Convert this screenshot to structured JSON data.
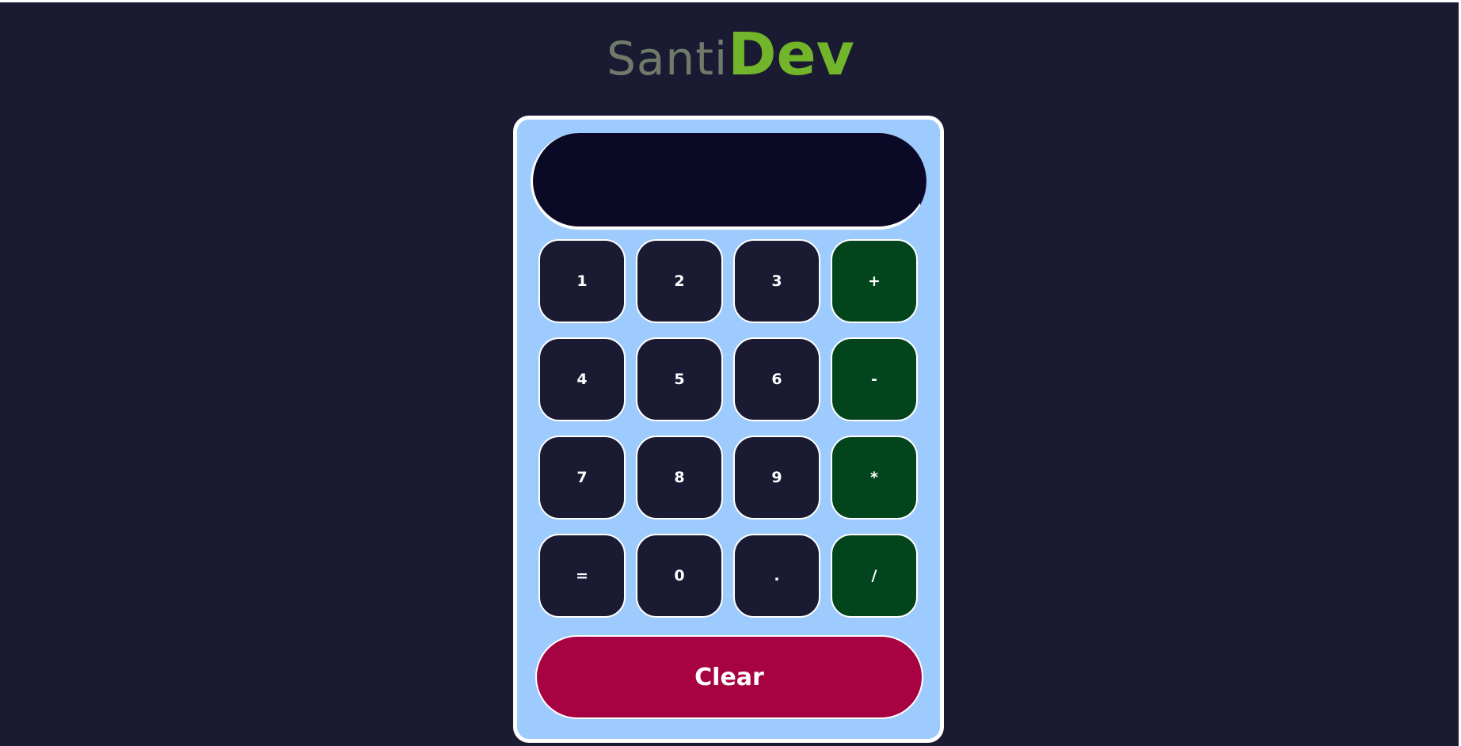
{
  "logo": {
    "part1": "Santi",
    "part2": "Dev"
  },
  "display": {
    "value": ""
  },
  "keys": [
    {
      "label": "1",
      "type": "digit"
    },
    {
      "label": "2",
      "type": "digit"
    },
    {
      "label": "3",
      "type": "digit"
    },
    {
      "label": "+",
      "type": "operator"
    },
    {
      "label": "4",
      "type": "digit"
    },
    {
      "label": "5",
      "type": "digit"
    },
    {
      "label": "6",
      "type": "digit"
    },
    {
      "label": "-",
      "type": "operator"
    },
    {
      "label": "7",
      "type": "digit"
    },
    {
      "label": "8",
      "type": "digit"
    },
    {
      "label": "9",
      "type": "digit"
    },
    {
      "label": "*",
      "type": "operator"
    },
    {
      "label": "=",
      "type": "digit"
    },
    {
      "label": "0",
      "type": "digit"
    },
    {
      "label": ".",
      "type": "digit"
    },
    {
      "label": "/",
      "type": "operator"
    }
  ],
  "clear": {
    "label": "Clear"
  },
  "colors": {
    "page_background": "#1b1a33",
    "calculator_body": "#9ecbfd",
    "display_background": "#0a0a26",
    "digit_key": "#1b1a33",
    "operator_key": "#02451c",
    "clear_button": "#a70342",
    "logo_gray": "#6f7a6b",
    "logo_green": "#72b52a"
  }
}
